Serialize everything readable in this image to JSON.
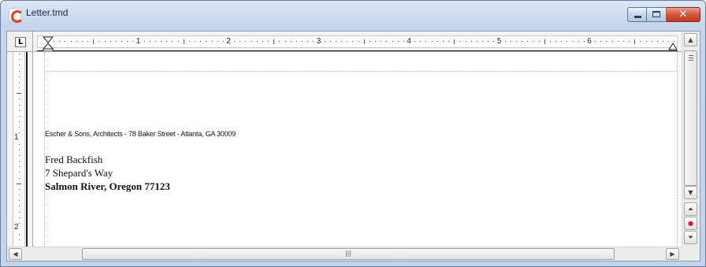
{
  "window": {
    "title": "Letter.tmd",
    "app_icon": "textmaker-document-icon",
    "controls": {
      "minimize": "minimize-icon",
      "maximize": "maximize-icon",
      "close_glyph": "✕"
    }
  },
  "ruler": {
    "tab_selector": "L",
    "horizontal_numbers": [
      "1",
      "2",
      "3",
      "4",
      "5",
      "6"
    ],
    "vertical_numbers": [
      "1",
      "2"
    ]
  },
  "document": {
    "letterhead": "Escher & Sons, Architects - 78 Baker Street - Atlanta, GA 30009",
    "recipient": {
      "name": "Fred Backfish",
      "street": "7 Shepard's Way",
      "city_line": "Salmon River, Oregon 77123"
    }
  },
  "scrollbars": {
    "up_arrow": "▲",
    "down_arrow": "▼",
    "left_arrow": "◀",
    "right_arrow": "▶",
    "prev_page": "⏶",
    "browse_object": "●",
    "next_page": "⏷",
    "hthumb_grip": "|||"
  },
  "colors": {
    "close_button": "#c23a1f",
    "browse_dot": "#e0192a",
    "app_icon": "#e2421d"
  }
}
